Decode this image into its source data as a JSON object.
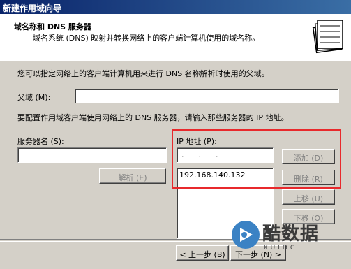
{
  "window": {
    "title": "新建作用域向导"
  },
  "header": {
    "title": "域名称和 DNS 服务器",
    "subtitle": "域名系统 (DNS) 映射并转换网络上的客户端计算机使用的域名称。"
  },
  "intro_text": "您可以指定网络上的客户端计算机用来进行 DNS 名称解析时使用的父域。",
  "parent_domain": {
    "label": "父域 (M):",
    "value": ""
  },
  "dns_instruction": "要配置作用域客户端使用网络上的 DNS 服务器，请输入那些服务器的 IP 地址。",
  "server_name": {
    "label": "服务器名 (S):",
    "value": ""
  },
  "resolve_button": "解析 (E)",
  "ip": {
    "label": "IP 地址 (P):",
    "field_value": ".      .      .",
    "list": [
      "192.168.140.132"
    ]
  },
  "buttons": {
    "add": "添加 (D)",
    "remove": "删除 (R)",
    "up": "上移 (U)",
    "down": "下移 (O)"
  },
  "nav": {
    "back": "< 上一步 (B)",
    "next": "下一步 (N) >"
  },
  "watermark": {
    "text": "酷数据",
    "sub": "KUIDC"
  },
  "colors": {
    "highlight": "#e8292c",
    "titlebar": "#0a246a"
  }
}
